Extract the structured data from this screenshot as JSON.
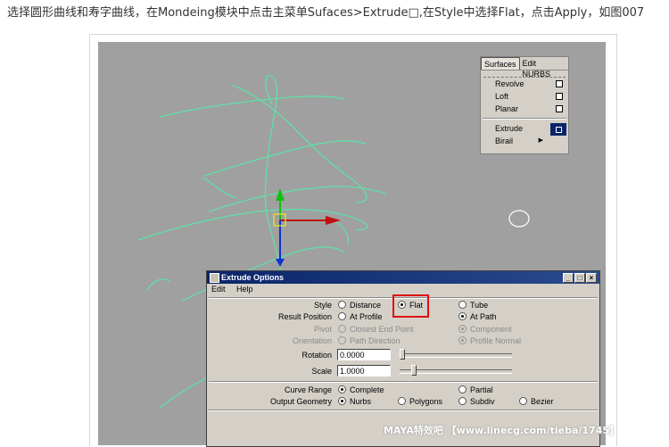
{
  "caption": "选择圆形曲线和寿字曲线，在Mondeing模块中点击主菜单Sufaces>Extrude□,在Style中选择Flat，点击Apply，如图007",
  "menu": {
    "tabs": [
      "Surfaces",
      "Edit NURBS"
    ],
    "items": [
      {
        "label": "Revolve"
      },
      {
        "label": "Loft"
      },
      {
        "label": "Planar"
      },
      {
        "label": "Extrude"
      },
      {
        "label": "Birail"
      }
    ]
  },
  "dialog": {
    "title": "Extrude Options",
    "menus": [
      "Edit",
      "Help"
    ],
    "style": {
      "label": "Style",
      "options": [
        "Distance",
        "Flat",
        "Tube"
      ],
      "selected": "Flat"
    },
    "result_position": {
      "label": "Result Position",
      "options": [
        "At Profile",
        "At Path"
      ],
      "selected": "At Path"
    },
    "pivot": {
      "label": "Pivot",
      "options": [
        "Closest End Point",
        "Component"
      ],
      "selected": "Component"
    },
    "orientation": {
      "label": "Orientation",
      "options": [
        "Path Direction",
        "Profile Normal"
      ],
      "selected": "Profile Normal"
    },
    "rotation": {
      "label": "Rotation",
      "value": "0.0000",
      "slider_fraction": 0.0
    },
    "scale": {
      "label": "Scale",
      "value": "1.0000",
      "slider_fraction": 0.1
    },
    "curve_range": {
      "label": "Curve Range",
      "options": [
        "Complete",
        "Partial"
      ],
      "selected": "Complete"
    },
    "output_geometry": {
      "label": "Output Geometry",
      "options": [
        "Nurbs",
        "Polygons",
        "Subdiv",
        "Bezier"
      ],
      "selected": "Nurbs"
    }
  },
  "watermark": "MAYA特效吧 【www.linecg.com/tieba/1745】",
  "colors": {
    "viewport": "#a0a0a0",
    "curve": "#5fe0a8",
    "highlight": "#e01010",
    "titlebar": "#0a246a"
  }
}
